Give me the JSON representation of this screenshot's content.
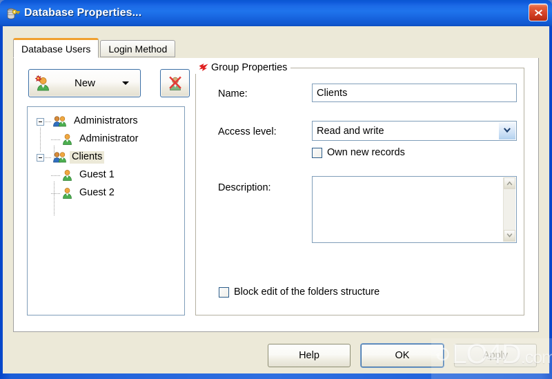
{
  "window": {
    "title": "Database Properties...",
    "icon": "database-key-icon",
    "close_label": "Close",
    "frame_color": "#1f74ec",
    "dialog_bg": "#ece9d8"
  },
  "tabs": [
    {
      "label": "Database Users",
      "active": true
    },
    {
      "label": "Login Method",
      "active": false
    }
  ],
  "toolbar": {
    "new_button": {
      "label": "New",
      "icon": "new-user-icon",
      "caret": "chevron-down-icon"
    },
    "delete_button": {
      "label": "",
      "icon": "delete-user-icon"
    }
  },
  "tree": {
    "nodes": [
      {
        "label": "Administrators",
        "type": "group",
        "expanded": true,
        "selected": false,
        "depth": 0
      },
      {
        "label": "Administrator",
        "type": "user",
        "expanded": false,
        "selected": false,
        "depth": 1
      },
      {
        "label": "Clients",
        "type": "group",
        "expanded": true,
        "selected": true,
        "depth": 0
      },
      {
        "label": "Guest 1",
        "type": "user",
        "expanded": false,
        "selected": false,
        "depth": 1
      },
      {
        "label": "Guest 2",
        "type": "user",
        "expanded": false,
        "selected": false,
        "depth": 1
      }
    ],
    "selection_bg": "#ece9d8"
  },
  "group_properties": {
    "legend": "Group Properties",
    "legend_icon": "red-arrow-icon",
    "name": {
      "label": "Name:",
      "value": "Clients",
      "placeholder": ""
    },
    "access_level": {
      "label": "Access level:",
      "value": "Read and write",
      "options": [
        "Read and write"
      ]
    },
    "own_new_records": {
      "label": "Own new records",
      "checked": false
    },
    "description": {
      "label": "Description:",
      "value": "",
      "placeholder": ""
    },
    "block_edit": {
      "label": "Block edit of the folders structure",
      "checked": false
    }
  },
  "footer": {
    "help": "Help",
    "ok": "OK",
    "apply": "Apply",
    "apply_disabled": true,
    "ok_focused": true
  },
  "watermark": {
    "main": "LO4D",
    "suffix": ".com"
  }
}
